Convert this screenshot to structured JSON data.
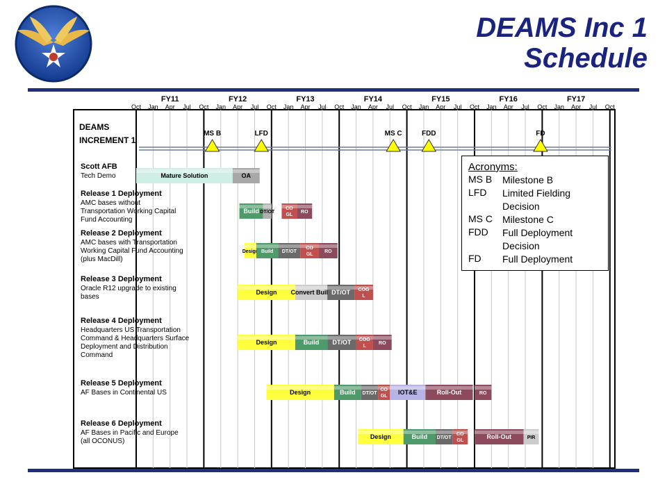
{
  "slide": {
    "title_line1": "DEAMS Inc 1",
    "title_line2": "Schedule",
    "logo": "air-force-star-wings-emblem",
    "colors": {
      "title": "#1a237e",
      "rule": "#1f2f7a"
    }
  },
  "chart_data": {
    "type": "gantt",
    "fiscal_years": [
      "FY11",
      "FY12",
      "FY13",
      "FY14",
      "FY15",
      "FY16",
      "FY17"
    ],
    "quarter_ticks": [
      "Oct",
      "Jan",
      "Apr",
      "Jul",
      "Oct",
      "Jan",
      "Apr",
      "Jul",
      "Oct",
      "Jan",
      "Apr",
      "Jul",
      "Oct",
      "Jan",
      "Apr",
      "Jul",
      "Oct",
      "Jan",
      "Apr",
      "Jul",
      "Oct",
      "Jan",
      "Apr",
      "Jul",
      "Oct",
      "Jan",
      "Apr",
      "Jul",
      "Oct"
    ],
    "program_label_line1": "DEAMS",
    "program_label_line2": "INCREMENT 1",
    "milestones": [
      {
        "label": "MS B",
        "q": 4.5
      },
      {
        "label": "LFD",
        "q": 7.4
      },
      {
        "label": "MS C",
        "q": 15.2
      },
      {
        "label": "FDD",
        "q": 17.3
      },
      {
        "label": "FD",
        "q": 23.9
      }
    ],
    "rows": [
      {
        "title": "Scott AFB",
        "desc": [
          "Tech Demo"
        ],
        "yc": 253,
        "bars": [
          {
            "label": "Mature Solution",
            "start": 0,
            "end": 5.7,
            "color": "#cfeee6"
          },
          {
            "label": "OA",
            "start": 5.7,
            "end": 7.3,
            "color": "#a8a8a8"
          }
        ]
      },
      {
        "title": "Release 1 Deployment",
        "desc": [
          "AMC bases without",
          "Transportation Working Capital",
          "Fund Accounting"
        ],
        "yc": 304,
        "bars": [
          {
            "label": "Build",
            "start": 6.1,
            "end": 7.5,
            "color": "#4e9a6a"
          },
          {
            "label": "DT/OT",
            "start": 7.5,
            "end": 8.0,
            "color": "#b0b0b0"
          },
          {
            "label": "CO GL",
            "start": 8.6,
            "end": 9.5,
            "color": "#c0504d"
          },
          {
            "label": "RO",
            "start": 9.5,
            "end": 10.4,
            "color": "#8c4a5c"
          }
        ]
      },
      {
        "title": "Release 2 Deployment",
        "desc": [
          "AMC bases with  Transportation",
          "Working Capital Fund Accounting",
          "(plus MacDill)"
        ],
        "yc": 361,
        "bars": [
          {
            "label": "Design",
            "start": 6.4,
            "end": 7.1,
            "color": "#ffff40"
          },
          {
            "label": "Build",
            "start": 7.1,
            "end": 8.4,
            "color": "#4e9a6a"
          },
          {
            "label": "DT/OT",
            "start": 8.4,
            "end": 9.7,
            "color": "#6a6a6a"
          },
          {
            "label": "CO GL",
            "start": 9.7,
            "end": 10.8,
            "color": "#c0504d"
          },
          {
            "label": "RO",
            "start": 10.8,
            "end": 11.9,
            "color": "#8c4a5c"
          }
        ]
      },
      {
        "title": "Release 3 Deployment",
        "desc": [
          "Oracle R12 upgrade to existing",
          "bases"
        ],
        "yc": 421,
        "bars": [
          {
            "label": "Design",
            "start": 6.0,
            "end": 9.4,
            "color": "#ffff40"
          },
          {
            "label": "Convert Build",
            "start": 9.4,
            "end": 11.3,
            "color": "#cccccc"
          },
          {
            "label": "DT/OT",
            "start": 11.3,
            "end": 12.9,
            "color": "#6a6a6a"
          },
          {
            "label": "COG L",
            "start": 12.9,
            "end": 14.0,
            "color": "#c0504d"
          }
        ]
      },
      {
        "title": "Release 4  Deployment",
        "desc": [
          "Headquarters US Transportation",
          "Command & Headquarters Surface",
          "Deployment and Distribution",
          "Command"
        ],
        "yc": 493,
        "bars": [
          {
            "label": "Design",
            "start": 6.0,
            "end": 9.4,
            "color": "#ffff40"
          },
          {
            "label": "Build",
            "start": 9.4,
            "end": 11.3,
            "color": "#4e9a6a"
          },
          {
            "label": "DT/OT",
            "start": 11.3,
            "end": 13.0,
            "color": "#6a6a6a"
          },
          {
            "label": "COG L",
            "start": 13.0,
            "end": 14.0,
            "color": "#c0504d"
          },
          {
            "label": "RO",
            "start": 14.0,
            "end": 15.1,
            "color": "#8c4a5c"
          }
        ]
      },
      {
        "title": "Release 5 Deployment",
        "desc": [
          "AF Bases in Continental US"
        ],
        "yc": 565,
        "bars": [
          {
            "label": "Design",
            "start": 7.7,
            "end": 11.7,
            "color": "#ffff40"
          },
          {
            "label": "Build",
            "start": 11.7,
            "end": 13.3,
            "color": "#4e9a6a"
          },
          {
            "label": "DT/OT",
            "start": 13.3,
            "end": 14.3,
            "color": "#6a6a6a"
          },
          {
            "label": "CO GL",
            "start": 14.3,
            "end": 15.0,
            "color": "#c0504d"
          },
          {
            "label": "IOT&E",
            "start": 15.0,
            "end": 17.1,
            "color": "#b7b3e6"
          },
          {
            "label": "Roll-Out",
            "start": 17.1,
            "end": 19.9,
            "color": "#8c4a5c"
          },
          {
            "label": "RO",
            "start": 20.0,
            "end": 21.0,
            "color": "#8c4a5c"
          }
        ]
      },
      {
        "title": "Release 6 Deployment",
        "desc": [
          "AF Bases in Pacific and Europe",
          "(all OCONUS)"
        ],
        "yc": 629,
        "bars": [
          {
            "label": "Design",
            "start": 13.1,
            "end": 15.8,
            "color": "#ffff40"
          },
          {
            "label": "Build",
            "start": 15.8,
            "end": 17.7,
            "color": "#4e9a6a"
          },
          {
            "label": "DT/OT",
            "start": 17.7,
            "end": 18.7,
            "color": "#6a6a6a"
          },
          {
            "label": "CO GL",
            "start": 18.7,
            "end": 19.6,
            "color": "#c0504d"
          },
          {
            "label": "Roll-Out",
            "start": 20.0,
            "end": 22.9,
            "color": "#8c4a5c"
          },
          {
            "label": "PIR",
            "start": 22.9,
            "end": 23.8,
            "color": "#cccccc"
          }
        ]
      }
    ]
  },
  "legend": {
    "heading": "Acronyms:",
    "items": [
      {
        "abbr": "MS B",
        "definition": "Milestone B"
      },
      {
        "abbr": "LFD",
        "definition": "Limited Fielding Decision"
      },
      {
        "abbr": "MS C",
        "definition": "Milestone C"
      },
      {
        "abbr": "FDD",
        "definition": "Full Deployment Decision"
      },
      {
        "abbr": "FD",
        "definition": "Full Deployment"
      }
    ]
  }
}
